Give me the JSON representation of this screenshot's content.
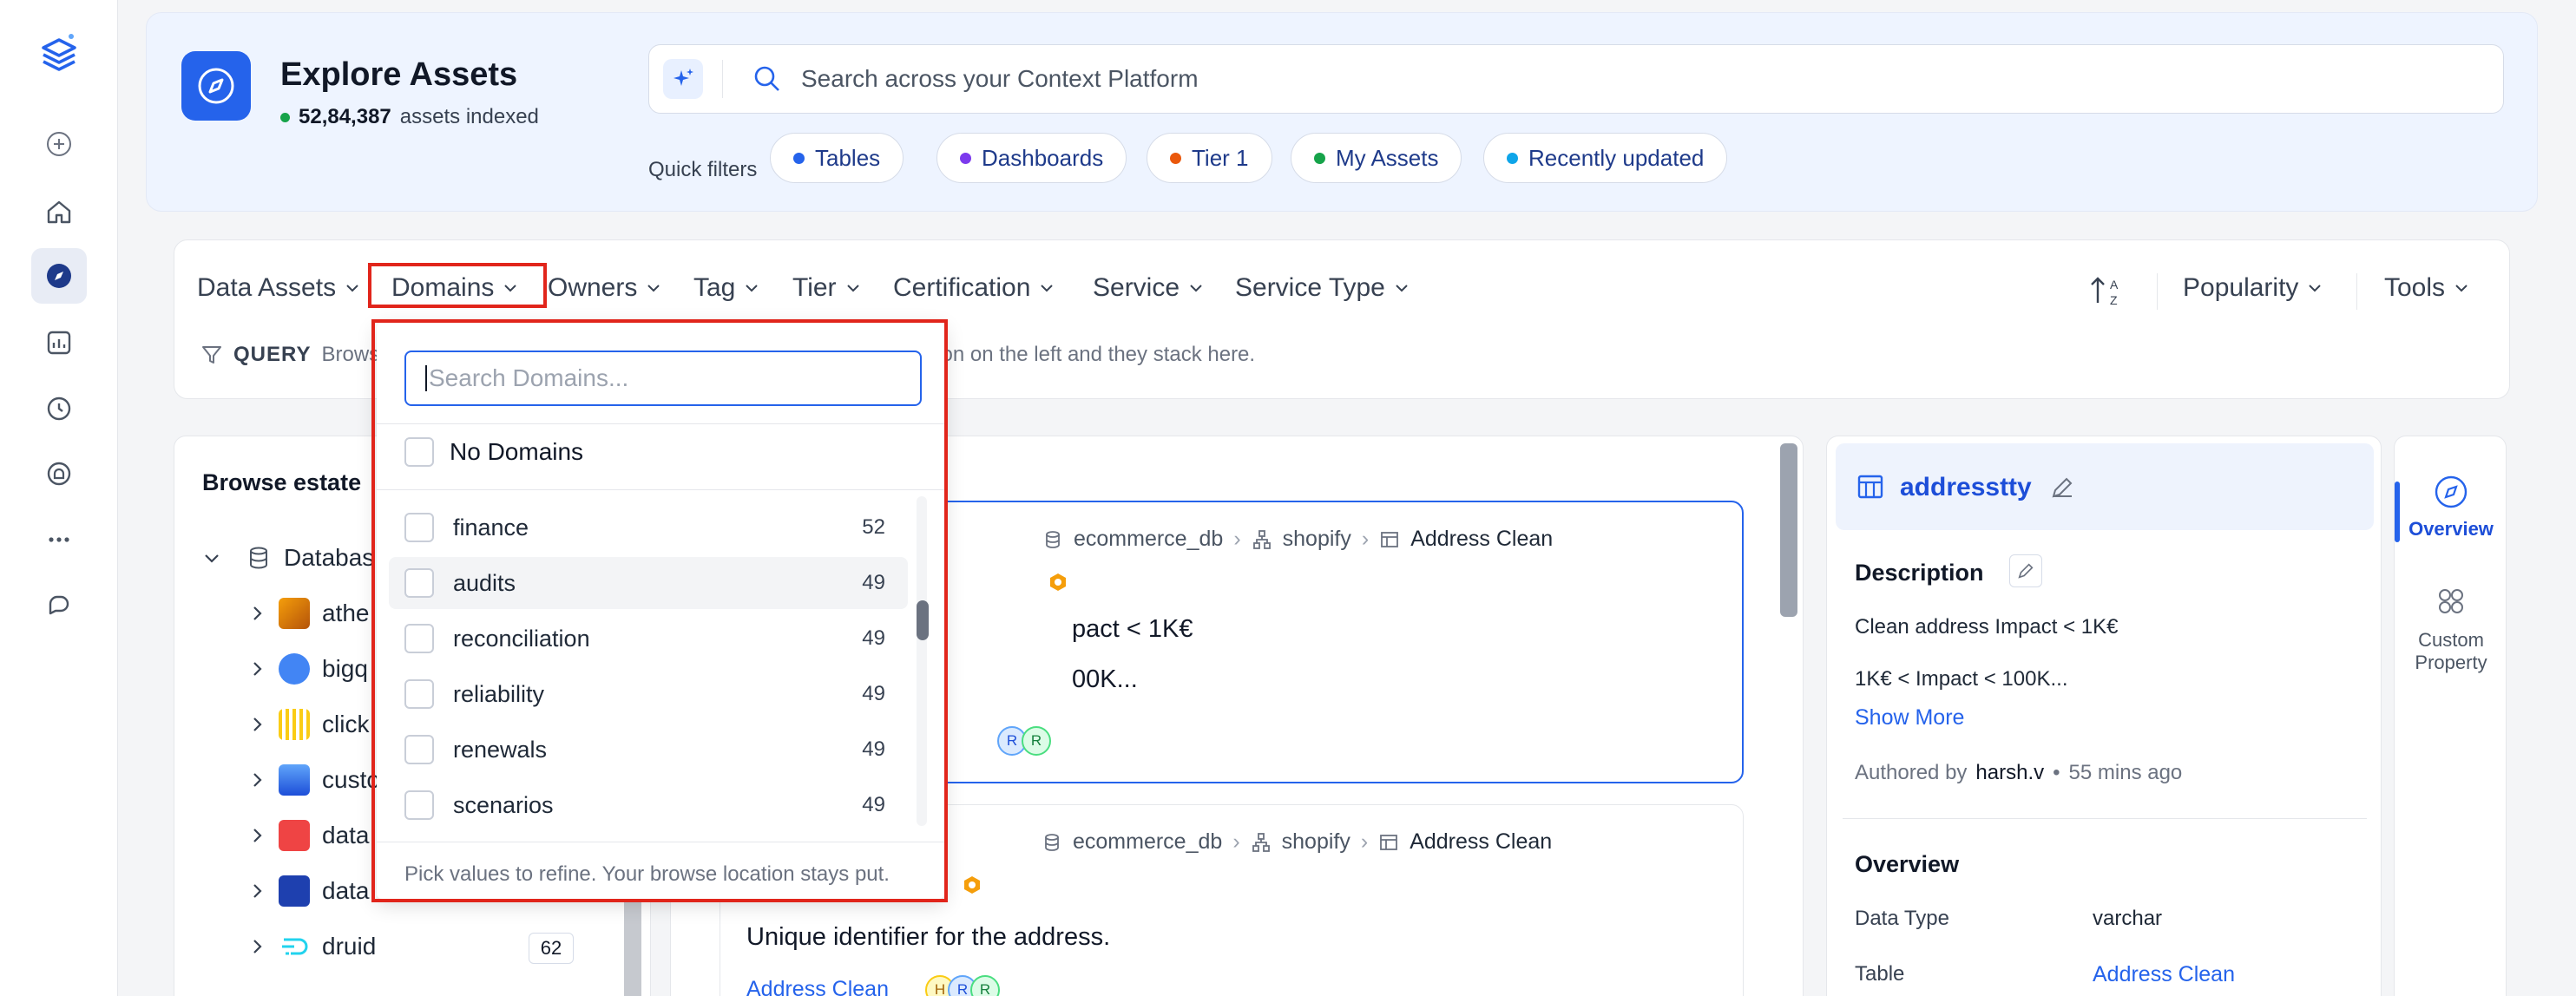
{
  "header": {
    "title": "Explore Assets",
    "assets_count": "52,84,387",
    "assets_suffix": "assets indexed",
    "search_placeholder": "Search across your Context Platform",
    "quick_filters_label": "Quick filters",
    "quick_filters": [
      {
        "label": "Tables",
        "color": "#2563eb"
      },
      {
        "label": "Dashboards",
        "color": "#7c3aed"
      },
      {
        "label": "Tier 1",
        "color": "#ea580c"
      },
      {
        "label": "My Assets",
        "color": "#16a34a"
      },
      {
        "label": "Recently updated",
        "color": "#0ea5e9"
      }
    ]
  },
  "filters": {
    "items": [
      "Data Assets",
      "Domains",
      "Owners",
      "Tag",
      "Tier",
      "Certification",
      "Service",
      "Service Type"
    ],
    "sort_label": "Popularity",
    "tools_label": "Tools",
    "query_label": "QUERY",
    "query_hint_left": "Brows",
    "query_hint_right": "ation on the left and they stack here."
  },
  "browse": {
    "title": "Browse estate",
    "root_label": "Databas",
    "items": [
      {
        "label": "athe",
        "icon": "athena-icon"
      },
      {
        "label": "bigq",
        "icon": "bigquery-icon"
      },
      {
        "label": "click",
        "icon": "clickhouse-icon"
      },
      {
        "label": "custo",
        "icon": "custom-db-icon"
      },
      {
        "label": "data",
        "icon": "databricks-icon"
      },
      {
        "label": "data",
        "icon": "datalake-icon"
      },
      {
        "label": "druid",
        "icon": "druid-icon",
        "count": "62"
      }
    ]
  },
  "results": {
    "card1": {
      "bc_db": "ecommerce_db",
      "bc_schema": "shopify",
      "bc_table": "Address Clean",
      "line1": "pact < 1K€",
      "line2": "00K..."
    },
    "card2": {
      "bc_db": "ecommerce_db",
      "bc_schema": "shopify",
      "bc_table": "Address Clean",
      "desc": "Unique identifier for the address.",
      "link": "Address Clean"
    }
  },
  "detail": {
    "name": "addresstty",
    "description_title": "Description",
    "desc_line1": "Clean address Impact < 1K€",
    "desc_line2": "1K€ < Impact < 100K...",
    "show_more": "Show More",
    "authored_by": "Authored by",
    "author": "harsh.v",
    "time_ago": "55 mins ago",
    "overview_title": "Overview",
    "data_type_label": "Data Type",
    "data_type_value": "varchar",
    "table_label": "Table",
    "table_value": "Address Clean"
  },
  "right_tabs": {
    "overview": "Overview",
    "custom_property_1": "Custom",
    "custom_property_2": "Property"
  },
  "dropdown": {
    "search_placeholder": "Search Domains...",
    "no_domains": "No Domains",
    "items": [
      {
        "label": "finance",
        "count": "52"
      },
      {
        "label": "audits",
        "count": "49"
      },
      {
        "label": "reconciliation",
        "count": "49"
      },
      {
        "label": "reliability",
        "count": "49"
      },
      {
        "label": "renewals",
        "count": "49"
      },
      {
        "label": "scenarios",
        "count": "49"
      }
    ],
    "footer": "Pick values to refine. Your browse location stays put."
  }
}
